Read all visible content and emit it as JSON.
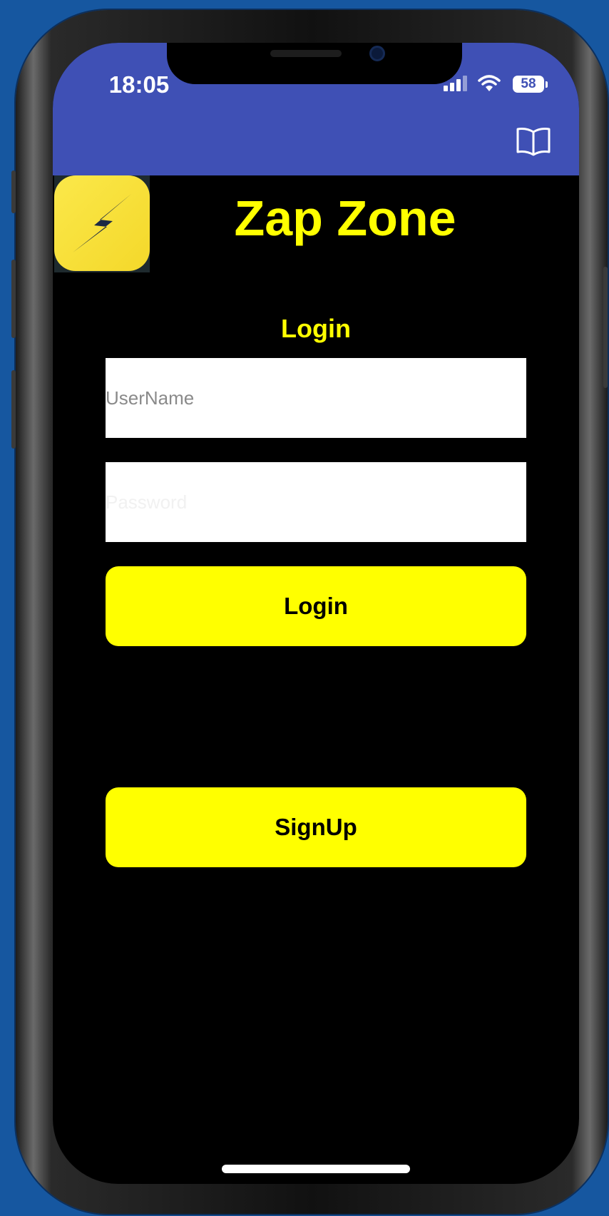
{
  "status_bar": {
    "time": "18:05",
    "battery": "58"
  },
  "header": {
    "background_color": "#3f50b5",
    "book_icon": "book-open-icon"
  },
  "app": {
    "title": "Zap Zone",
    "logo_icon": "lightning-bolt-icon",
    "accent_color": "#ffff00"
  },
  "login_form": {
    "heading": "Login",
    "username_placeholder": "UserName",
    "password_placeholder": "Password",
    "login_button": "Login",
    "signup_button": "SignUp"
  }
}
